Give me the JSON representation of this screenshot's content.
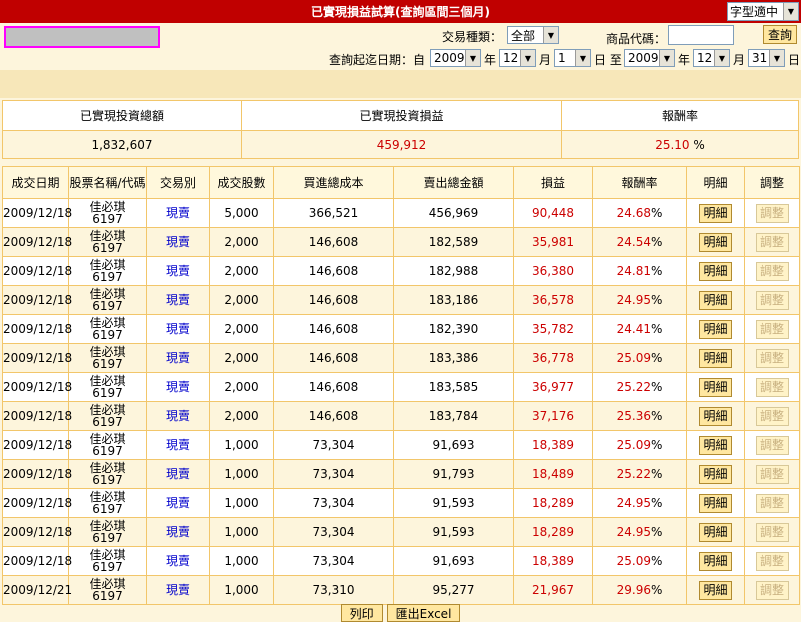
{
  "header": {
    "title": "已實現損益試算(查詢區間三個月)",
    "font_size_select": "字型適中"
  },
  "filters": {
    "trade_type_label": "交易種類：",
    "trade_type_value": "全部",
    "product_code_label": "商品代碼：",
    "product_code_value": "",
    "query_button": "查詢",
    "date_range_label": "查詢起迄日期：自",
    "start_year": "2009",
    "start_month": "12",
    "start_day": "1",
    "end_year": "2009",
    "end_month": "12",
    "end_day": "31",
    "year_unit": "年",
    "month_unit": "月",
    "day_unit_to": "日 至",
    "day_unit": "日"
  },
  "summary": {
    "headers": [
      "已實現投資總額",
      "已實現投資損益",
      "報酬率"
    ],
    "total_investment": "1,832,607",
    "total_profit": "459,912",
    "return_rate": "25.10",
    "percent_sign": "%"
  },
  "table": {
    "columns": [
      "成交日期",
      "股票名稱/代碼",
      "交易別",
      "成交股數",
      "買進總成本",
      "賣出總金額",
      "損益",
      "報酬率",
      "明細",
      "調整"
    ],
    "detail_label": "明細",
    "adjust_label": "調整",
    "rows": [
      {
        "date": "2009/12/18",
        "name": "佳必琪",
        "code": "6197",
        "type": "現賣",
        "shares": "5,000",
        "cost": "366,521",
        "proceeds": "456,969",
        "profit": "90,448",
        "rate": "24.68"
      },
      {
        "date": "2009/12/18",
        "name": "佳必琪",
        "code": "6197",
        "type": "現賣",
        "shares": "2,000",
        "cost": "146,608",
        "proceeds": "182,589",
        "profit": "35,981",
        "rate": "24.54"
      },
      {
        "date": "2009/12/18",
        "name": "佳必琪",
        "code": "6197",
        "type": "現賣",
        "shares": "2,000",
        "cost": "146,608",
        "proceeds": "182,988",
        "profit": "36,380",
        "rate": "24.81"
      },
      {
        "date": "2009/12/18",
        "name": "佳必琪",
        "code": "6197",
        "type": "現賣",
        "shares": "2,000",
        "cost": "146,608",
        "proceeds": "183,186",
        "profit": "36,578",
        "rate": "24.95"
      },
      {
        "date": "2009/12/18",
        "name": "佳必琪",
        "code": "6197",
        "type": "現賣",
        "shares": "2,000",
        "cost": "146,608",
        "proceeds": "182,390",
        "profit": "35,782",
        "rate": "24.41"
      },
      {
        "date": "2009/12/18",
        "name": "佳必琪",
        "code": "6197",
        "type": "現賣",
        "shares": "2,000",
        "cost": "146,608",
        "proceeds": "183,386",
        "profit": "36,778",
        "rate": "25.09"
      },
      {
        "date": "2009/12/18",
        "name": "佳必琪",
        "code": "6197",
        "type": "現賣",
        "shares": "2,000",
        "cost": "146,608",
        "proceeds": "183,585",
        "profit": "36,977",
        "rate": "25.22"
      },
      {
        "date": "2009/12/18",
        "name": "佳必琪",
        "code": "6197",
        "type": "現賣",
        "shares": "2,000",
        "cost": "146,608",
        "proceeds": "183,784",
        "profit": "37,176",
        "rate": "25.36"
      },
      {
        "date": "2009/12/18",
        "name": "佳必琪",
        "code": "6197",
        "type": "現賣",
        "shares": "1,000",
        "cost": "73,304",
        "proceeds": "91,693",
        "profit": "18,389",
        "rate": "25.09"
      },
      {
        "date": "2009/12/18",
        "name": "佳必琪",
        "code": "6197",
        "type": "現賣",
        "shares": "1,000",
        "cost": "73,304",
        "proceeds": "91,793",
        "profit": "18,489",
        "rate": "25.22"
      },
      {
        "date": "2009/12/18",
        "name": "佳必琪",
        "code": "6197",
        "type": "現賣",
        "shares": "1,000",
        "cost": "73,304",
        "proceeds": "91,593",
        "profit": "18,289",
        "rate": "24.95"
      },
      {
        "date": "2009/12/18",
        "name": "佳必琪",
        "code": "6197",
        "type": "現賣",
        "shares": "1,000",
        "cost": "73,304",
        "proceeds": "91,593",
        "profit": "18,289",
        "rate": "24.95"
      },
      {
        "date": "2009/12/18",
        "name": "佳必琪",
        "code": "6197",
        "type": "現賣",
        "shares": "1,000",
        "cost": "73,304",
        "proceeds": "91,693",
        "profit": "18,389",
        "rate": "25.09"
      },
      {
        "date": "2009/12/21",
        "name": "佳必琪",
        "code": "6197",
        "type": "現賣",
        "shares": "1,000",
        "cost": "73,310",
        "proceeds": "95,277",
        "profit": "21,967",
        "rate": "29.96"
      }
    ]
  },
  "footer": {
    "print_button": "列印",
    "export_button": "匯出Excel"
  }
}
